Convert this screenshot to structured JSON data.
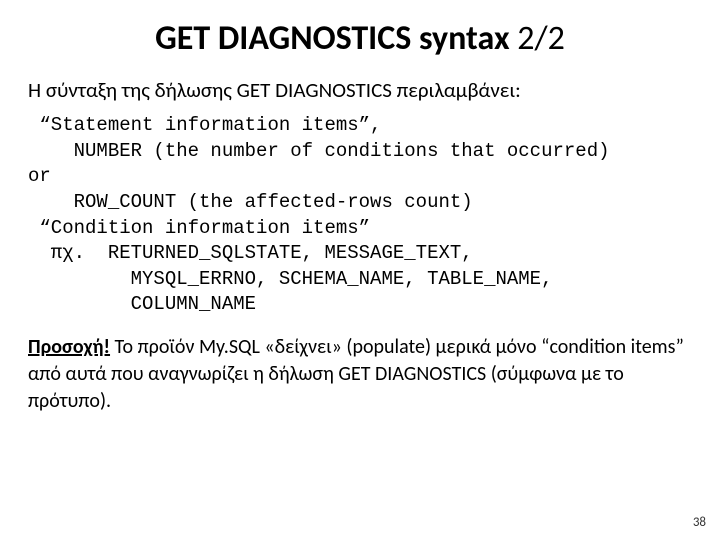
{
  "title_main": "GET DIAGNOSTICS syntax ",
  "title_frac": "2/2",
  "intro": "Η σύνταξη της δήλωσης GET DIAGNOSTICS περιλαμβάνει:",
  "code": " “Statement information items”,\n    NUMBER (the number of conditions that occurred)\nor\n    ROW_COUNT (the affected-rows count)\n “Condition information items”\n  πχ.  RETURNED_SQLSTATE, MESSAGE_TEXT,\n         MYSQL_ERRNO, SCHEMA_NAME, TABLE_NAME,\n         COLUMN_NAME",
  "warn_lead": "Προσοχή!",
  "warn_rest": " Το προϊόν My.SQL «δείχνει» (populate) μερικά μόνο “condition items” από αυτά που αναγνωρίζει η δήλωση GET DIAGNOSTICS (σύμφωνα με το πρότυπο).",
  "page": "38"
}
